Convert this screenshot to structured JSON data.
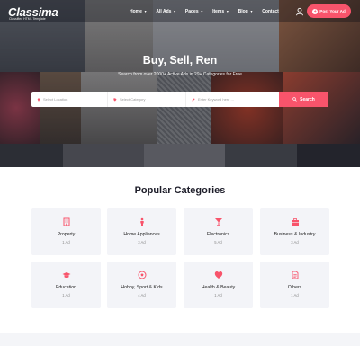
{
  "brand": {
    "logo": "Classima",
    "tagline": "Classified HTML Template"
  },
  "nav": {
    "items": [
      {
        "label": "Home",
        "dropdown": true
      },
      {
        "label": "All Ads",
        "dropdown": true
      },
      {
        "label": "Pages",
        "dropdown": true
      },
      {
        "label": "Items",
        "dropdown": true
      },
      {
        "label": "Blog",
        "dropdown": true
      },
      {
        "label": "Contact",
        "dropdown": false
      }
    ],
    "post_button": "Post Your Ad",
    "accent": "#f8546b"
  },
  "hero": {
    "headline": "Buy, Sell, Ren",
    "subline": "Search from over 2000+ Active Ads in 29+ Categories for Free"
  },
  "search": {
    "location_placeholder": "Select Location",
    "category_placeholder": "Select Category",
    "keyword_placeholder": "Enter Keyword here ...",
    "button": "Search"
  },
  "categories": {
    "title": "Popular Categories",
    "items": [
      {
        "name": "Property",
        "count": "1 Ad",
        "icon": "building-icon"
      },
      {
        "name": "Home Appliances",
        "count": "3 Ad",
        "icon": "person-icon"
      },
      {
        "name": "Electronics",
        "count": "5 Ad",
        "icon": "cocktail-icon"
      },
      {
        "name": "Business & Industry",
        "count": "3 Ad",
        "icon": "briefcase-icon"
      },
      {
        "name": "Education",
        "count": "1 Ad",
        "icon": "graduation-cap-icon"
      },
      {
        "name": "Hobby, Sport & Kids",
        "count": "4 Ad",
        "icon": "soccer-ball-icon"
      },
      {
        "name": "Health & Beauty",
        "count": "1 Ad",
        "icon": "heart-icon"
      },
      {
        "name": "Others",
        "count": "1 Ad",
        "icon": "document-icon"
      }
    ]
  }
}
